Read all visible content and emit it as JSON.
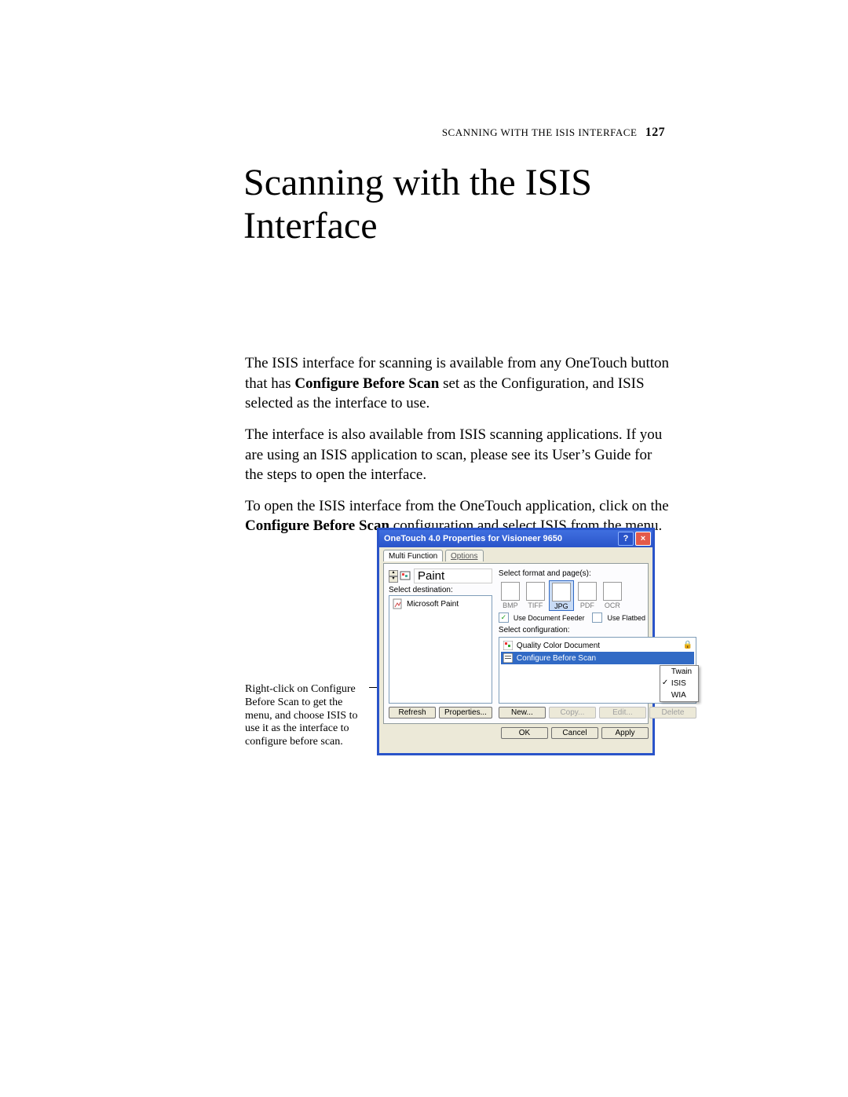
{
  "page": {
    "running_header_text": "Scanning with the ISIS Interface",
    "page_number": "127",
    "chapter_title": "Scanning with the ISIS\nInterface",
    "para1_a": "The ISIS interface for scanning is available from any OneTouch button that has ",
    "para1_bold": "Configure Before Scan",
    "para1_b": " set as the Configuration, and ISIS selected as the interface to use.",
    "para2": "The interface is also available from ISIS scanning applications. If you are using an ISIS application to scan, please see its User’s Guide for the steps to open the interface.",
    "para3_a": "To open the ISIS interface from the OneTouch application, click on the ",
    "para3_bold": "Configure Before Scan",
    "para3_b": " configuration and select ISIS from the menu.",
    "callout": "Right-click on Configure Before Scan to get the menu, and choose ISIS to use it as the interface to configure before scan."
  },
  "dialog": {
    "title": "OneTouch 4.0 Properties for Visioneer 9650",
    "help_glyph": "?",
    "close_glyph": "×",
    "tabs": {
      "multi_function": "Multi Function",
      "options": "Options"
    },
    "left": {
      "app_name": "Paint",
      "select_dest_label": "Select destination:",
      "destinations": [
        "Microsoft Paint"
      ]
    },
    "right": {
      "select_format_label": "Select format and page(s):",
      "formats": [
        {
          "label": "BMP",
          "disabled": false,
          "selected": false
        },
        {
          "label": "TIFF",
          "disabled": true,
          "selected": false
        },
        {
          "label": "JPG",
          "disabled": false,
          "selected": true
        },
        {
          "label": "PDF",
          "disabled": true,
          "selected": false
        },
        {
          "label": "OCR",
          "disabled": true,
          "selected": false
        }
      ],
      "use_document_feeder_label": "Use Document Feeder",
      "use_document_feeder_checked": true,
      "use_flatbed_label": "Use Flatbed",
      "use_flatbed_checked": false,
      "select_config_label": "Select configuration:",
      "configs": [
        {
          "label": "Quality Color Document",
          "selected": false
        },
        {
          "label": "Configure Before Scan",
          "selected": true
        }
      ],
      "context_menu": {
        "items": [
          "Twain",
          "ISIS",
          "WIA"
        ],
        "checked": "ISIS"
      }
    },
    "buttons": {
      "refresh": "Refresh",
      "properties": "Properties...",
      "new": "New...",
      "copy": "Copy...",
      "edit": "Edit...",
      "delete": "Delete",
      "ok": "OK",
      "cancel": "Cancel",
      "apply": "Apply"
    }
  }
}
